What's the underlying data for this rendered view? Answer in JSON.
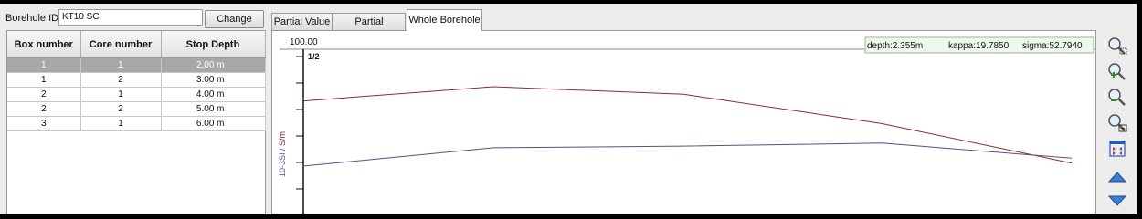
{
  "borehole": {
    "label": "Borehole ID:",
    "value": "KT10 SC",
    "change_label": "Change"
  },
  "table": {
    "headers": [
      "Box number",
      "Core number",
      "Stop Depth"
    ],
    "rows": [
      {
        "box": "1",
        "core": "1",
        "depth": "2.00 m",
        "selected": true
      },
      {
        "box": "1",
        "core": "2",
        "depth": "3.00 m",
        "selected": false
      },
      {
        "box": "2",
        "core": "1",
        "depth": "4.00 m",
        "selected": false
      },
      {
        "box": "2",
        "core": "2",
        "depth": "5.00 m",
        "selected": false
      },
      {
        "box": "3",
        "core": "1",
        "depth": "6.00 m",
        "selected": false
      }
    ]
  },
  "tabs": [
    {
      "label": "Partial Value",
      "active": false
    },
    {
      "label": "Partial Borehole",
      "active": false
    },
    {
      "label": "Whole Borehole",
      "active": true
    }
  ],
  "readout": {
    "depth": "depth:2.355m",
    "kappa": "kappa:19.7850",
    "sigma": "sigma:52.7940"
  },
  "chart_data": {
    "type": "line",
    "top_value_label": "100.00",
    "scale_label": "1/2",
    "ylabel_kappa": "10-3SI",
    "ylabel_sep": " / ",
    "ylabel_sigma": "S/m",
    "series": [
      {
        "name": "sigma",
        "color": "#8b2a3a",
        "values": [
          52.8,
          65.8,
          58.9,
          32.2,
          -3.9
        ],
        "x": [
          0,
          0.24,
          0.48,
          0.73,
          0.97
        ]
      },
      {
        "name": "kappa",
        "color": "#55508c",
        "values": [
          -6.7,
          10.1,
          11.6,
          14.3,
          0.6
        ],
        "x": [
          0,
          0.24,
          0.48,
          0.73,
          0.97
        ]
      }
    ],
    "ylim": [
      -50,
      100
    ]
  },
  "sidebar": {
    "icons": [
      "zoom-window-icon",
      "zoom-in-icon",
      "zoom-out-icon",
      "zoom-fit-icon",
      "fit-all-icon",
      "scroll-up-icon",
      "scroll-down-icon"
    ]
  },
  "colors": {
    "sigma_line": "#8b2a3a",
    "kappa_line": "#55508c",
    "selected_row": "#a8a8a8",
    "readout_bg": "#eef7ee"
  }
}
